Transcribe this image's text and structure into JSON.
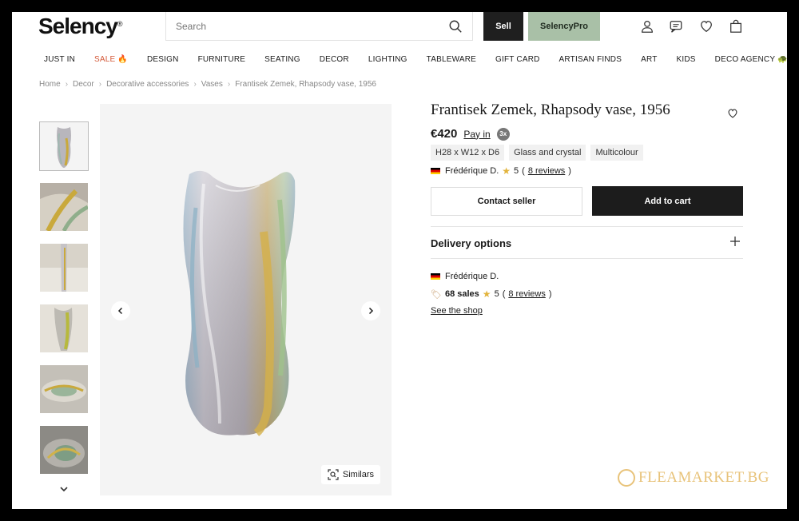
{
  "header": {
    "logo": "Selency",
    "logo_mark": "®",
    "search_placeholder": "Search",
    "sell_label": "Sell",
    "pro_label": "SelencyPro",
    "icons": [
      "user-icon",
      "message-icon",
      "heart-icon",
      "bag-icon"
    ]
  },
  "nav": [
    "JUST IN",
    "SALE 🔥",
    "DESIGN",
    "FURNITURE",
    "SEATING",
    "DECOR",
    "LIGHTING",
    "TABLEWARE",
    "GIFT CARD",
    "ARTISAN FINDS",
    "ART",
    "KIDS",
    "DECO AGENCY 🐢"
  ],
  "breadcrumb": [
    "Home",
    "Decor",
    "Decorative accessories",
    "Vases",
    "Frantisek Zemek, Rhapsody vase, 1956"
  ],
  "gallery": {
    "similars_label": "Similars",
    "thumb_count": 6
  },
  "product": {
    "title": "Frantisek Zemek, Rhapsody vase, 1956",
    "price": "€420",
    "pay_in": "Pay in",
    "pay_badge": "3x",
    "tags": [
      "H28 x W12 x D6",
      "Glass and crystal",
      "Multicolour"
    ],
    "seller": "Frédérique D.",
    "rating": "5",
    "reviews": "8 reviews",
    "contact_label": "Contact seller",
    "cart_label": "Add to cart"
  },
  "delivery": {
    "label": "Delivery options"
  },
  "shop": {
    "seller": "Frédérique D.",
    "sales": "68 sales",
    "rating": "5",
    "reviews": "8 reviews",
    "link": "See the shop"
  },
  "watermark": "FLEAMARKET.BG",
  "colors": {
    "accent_dark": "#1c1c1c",
    "pro_green": "#a9c0a7",
    "sale_red": "#d45a3a",
    "star": "#e2b33b"
  }
}
